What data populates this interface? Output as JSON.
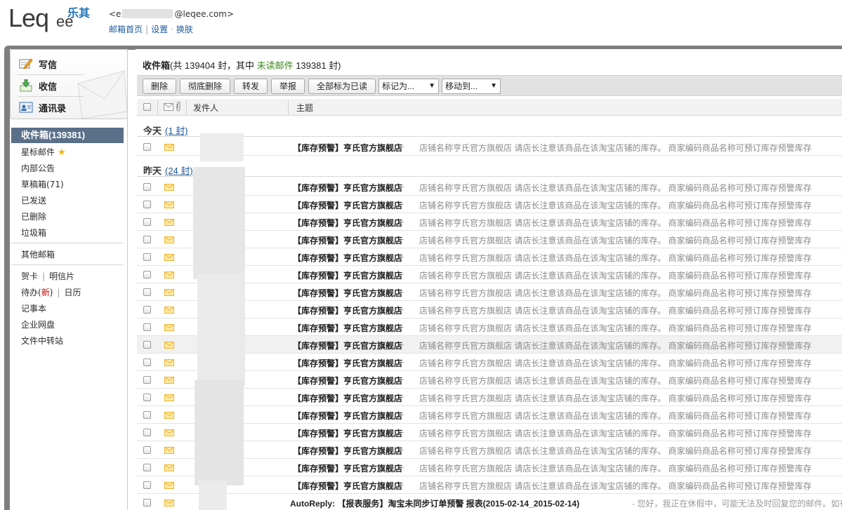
{
  "header": {
    "account_prefix": "<e",
    "account_suffix": "@leqee.com>",
    "links": [
      "邮箱首页",
      "设置",
      "换肤"
    ],
    "logo_text": "Leqee",
    "logo_cn": "乐其"
  },
  "quick": {
    "compose": "写信",
    "receive": "收信",
    "contacts": "通讯录"
  },
  "folders": {
    "inbox": "收件箱(139381)",
    "starred": "星标邮件",
    "notice": "内部公告",
    "drafts": "草稿箱(71)",
    "sent": "已发送",
    "deleted": "已删除",
    "trash": "垃圾箱",
    "other": "其他邮箱",
    "card": "贺卡",
    "postcard": "明信片",
    "todo_prefix": "待办(",
    "todo_new": "新",
    "todo_suffix": ")",
    "calendar": "日历",
    "notes": "记事本",
    "disk": "企业网盘",
    "transfer": "文件中转站"
  },
  "main": {
    "title_label": "收件箱",
    "title_part1": "(共 139404 封，其中 ",
    "title_unread": "未读邮件",
    "title_part2": " 139381 封)",
    "toolbar": {
      "delete": "删除",
      "perm_delete": "彻底删除",
      "forward": "转发",
      "report": "举报",
      "mark_all_read": "全部标为已读",
      "mark_as": "标记为...",
      "move_to": "移动到..."
    },
    "columns": {
      "sender": "发件人",
      "subject": "主题"
    },
    "groups": {
      "today": "今天",
      "today_count": "(1 封)",
      "yesterday": "昨天",
      "yesterday_count": "(24 封)"
    },
    "alert_subject": "【库存预警】亨氏官方旗舰店",
    "alert_preview": "店铺名称亨氏官方旗舰店 请店长注意该商品在该淘宝店铺的库存。 商家编码商品名称可预订库存预警库存",
    "dash": "-",
    "auto_subject": "AutoReply: 【报表服务】淘宝未同步订单预警 报表(2015-02-14_2015-02-14)",
    "auto_preview": "- 您好，我正在休假中，可能无法及时回复您的邮件。如有"
  },
  "colors": {
    "accent": "#5a6f88",
    "link": "#1e5aa0",
    "unread": "#3c8c1c",
    "new": "#d40000",
    "envelope": "#f0b429"
  }
}
